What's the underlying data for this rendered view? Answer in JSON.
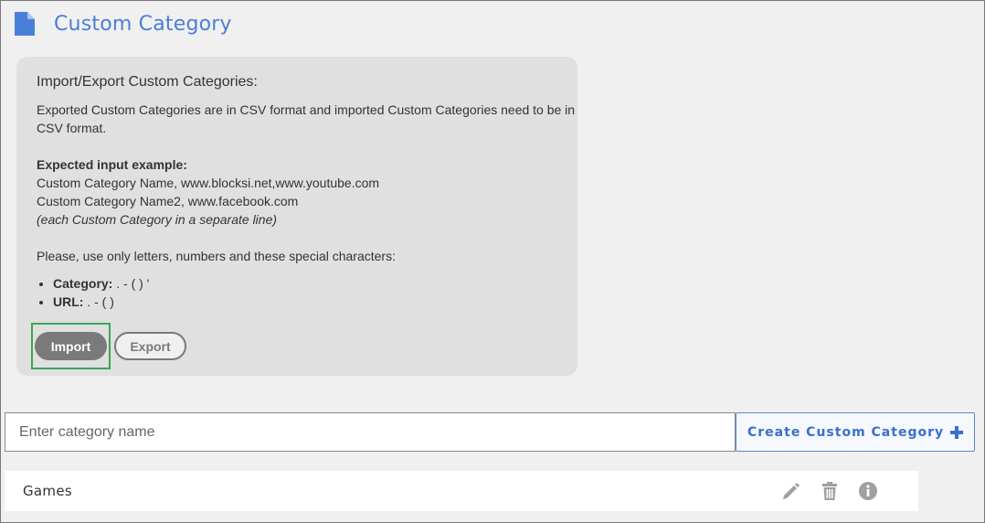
{
  "header": {
    "title": "Custom Category",
    "icon": "document-icon"
  },
  "panel": {
    "title": "Import/Export Custom Categories:",
    "description": "Exported Custom Categories are in CSV format and imported Custom Categories need to be in CSV format.",
    "example_heading": "Expected input example:",
    "example_line_1": "Custom Category Name, www.blocksi.net,www.youtube.com",
    "example_line_2": "Custom Category Name2, www.facebook.com",
    "example_note": "(each Custom Category in a separate line)",
    "chars_intro": "Please, use only letters, numbers and these special characters:",
    "rules": [
      {
        "label": "Category:",
        "chars": " . - ( ) '"
      },
      {
        "label": "URL:",
        "chars": " . - ( )"
      }
    ],
    "import_label": "Import",
    "export_label": "Export"
  },
  "create": {
    "placeholder": "Enter category name",
    "value": "",
    "button_label": "Create Custom Category"
  },
  "categories": [
    {
      "name": "Games"
    }
  ],
  "colors": {
    "accent": "#4a7fd9",
    "selection_outline": "#3aa655",
    "icon_gray": "#a0a0a0"
  }
}
